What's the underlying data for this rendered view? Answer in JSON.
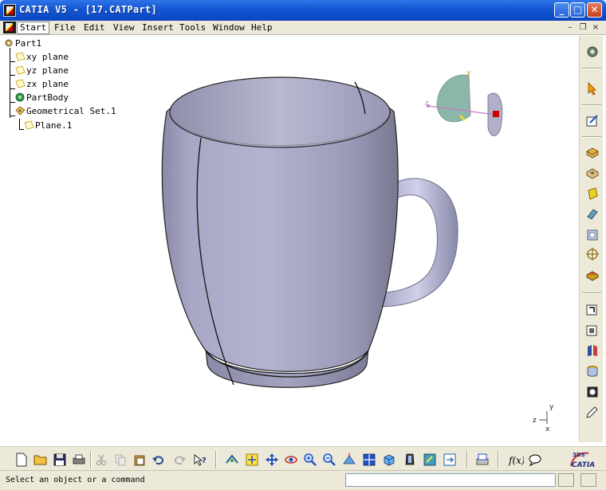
{
  "window": {
    "title": "CATIA V5 - [17.CATPart]",
    "minimize_glyph": "_",
    "maximize_glyph": "□",
    "close_glyph": "✕"
  },
  "menu": {
    "items": [
      {
        "label": "Start",
        "active": true
      },
      {
        "label": "File"
      },
      {
        "label": "Edit"
      },
      {
        "label": "View"
      },
      {
        "label": "Insert"
      },
      {
        "label": "Tools"
      },
      {
        "label": "Window"
      },
      {
        "label": "Help"
      }
    ],
    "doc_minimize_glyph": "–",
    "doc_restore_glyph": "❐",
    "doc_close_glyph": "×"
  },
  "tree": {
    "root": "Part1",
    "planes": [
      "xy plane",
      "yz plane",
      "zx plane"
    ],
    "body": "PartBody",
    "geo_set": "Geometrical Set.1",
    "geo_child": "Plane.1"
  },
  "compass": {
    "axis_x": "x",
    "axis_y": "y",
    "axis_z": "z"
  },
  "triad": {
    "axis_x": "x",
    "axis_y": "y",
    "axis_z": "z"
  },
  "status": {
    "message": "Select an object or a command",
    "command_value": ""
  },
  "brand": {
    "logo_text": "CATIA",
    "logo_mark": "3DS"
  },
  "colors": {
    "titlebar": "#0a46c0",
    "chrome": "#ece9d8",
    "mug_body": "#9d9dbb",
    "compass_green": "#7fb0a3"
  }
}
